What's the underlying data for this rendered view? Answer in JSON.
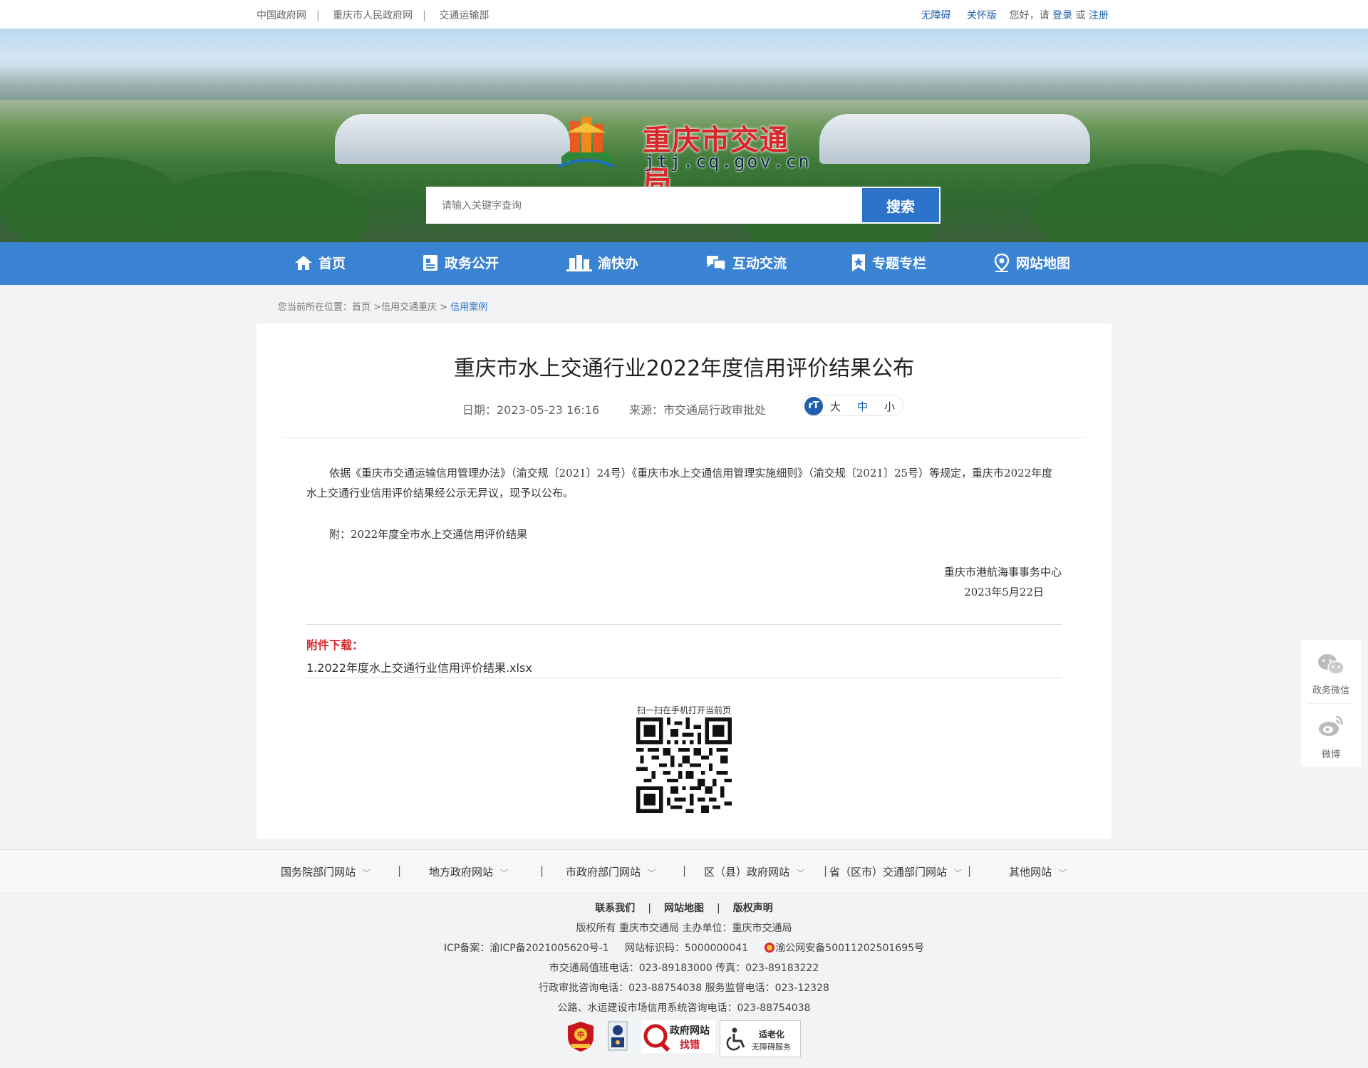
{
  "topbar": {
    "links": [
      "中国政府网",
      "重庆市人民政府网",
      "交通运输部"
    ],
    "accessibility": "无障碍",
    "elderly": "关怀版",
    "greeting": "您好，请",
    "login": "登录",
    "or": "或",
    "register": "注册"
  },
  "logo": {
    "name": "重庆市交通局",
    "domain": "jtj.cq.gov.cn"
  },
  "search": {
    "placeholder": "请输入关键字查询",
    "button": "搜索"
  },
  "nav": [
    {
      "label": "首页",
      "icon": "home-icon"
    },
    {
      "label": "政务公开",
      "icon": "document-icon"
    },
    {
      "label": "渝快办",
      "icon": "building-icon"
    },
    {
      "label": "互动交流",
      "icon": "chat-icon"
    },
    {
      "label": "专题专栏",
      "icon": "star-bookmark-icon"
    },
    {
      "label": "网站地图",
      "icon": "map-pin-icon"
    }
  ],
  "breadcrumb": {
    "prefix": "您当前所在位置：",
    "home": "首页",
    "sep": ">",
    "level2": "信用交通重庆",
    "current": "信用案例"
  },
  "article": {
    "title": "重庆市水上交通行业2022年度信用评价结果公布",
    "date": "日期：2023-05-23 16:16",
    "source": "来源：市交通局行政审批处",
    "font_sizes": [
      "大",
      "中",
      "小"
    ],
    "font_icon_label": "rT",
    "paragraph1": "依据《重庆市交通运输信用管理办法》（渝交规〔2021〕24号）《重庆市水上交通信用管理实施细则》（渝交规〔2021〕25号）等规定，重庆市2022年度水上交通行业信用评价结果经公示无异议，现予以公布。",
    "paragraph2": "附：2022年度全市水上交通信用评价结果",
    "signature": "重庆市港航海事事务中心",
    "sign_date": "2023年5月22日",
    "attachment_title": "附件下载：",
    "attachment_item": "1.2022年度水上交通行业信用评价结果.xlsx",
    "qr_label": "扫一扫在手机打开当前页"
  },
  "float": {
    "wechat": "政务微信",
    "weibo": "微博"
  },
  "footer_links": [
    "国务院部门网站",
    "地方政府网站",
    "市政府部门网站",
    "区（县）政府网站",
    "省（区市）交通部门网站",
    "其他网站"
  ],
  "footer": {
    "contact": "联系我们",
    "sitemap": "网站地图",
    "copyright_stmt": "版权声明",
    "owner": "版权所有 重庆市交通局    主办单位：重庆市交通局",
    "icp": "ICP备案：渝ICP备2021005620号-1",
    "site_id": "网站标识码：5000000041",
    "police": "渝公网安备50011202501695号",
    "duty_phone": "市交通局值班电话：023-89183000    传真：023-89183222",
    "approval_phone": "行政审批咨询电话：023-88754038    服务监督电话：023-12328",
    "credit_phone": "公路、水运建设市场信用系统咨询电话：023-88754038",
    "badge_gov_error": "政府网站",
    "badge_gov_error_sub": "找错",
    "badge_elderly": "适老化",
    "badge_elderly_sub": "无障碍服务",
    "badge_party": "党政机关"
  },
  "colors": {
    "nav_blue": "#3a83d2",
    "search_blue": "#2b72c9",
    "logo_red": "#d8262b",
    "attach_red": "#d8262b",
    "link_blue": "#1f5fae"
  }
}
